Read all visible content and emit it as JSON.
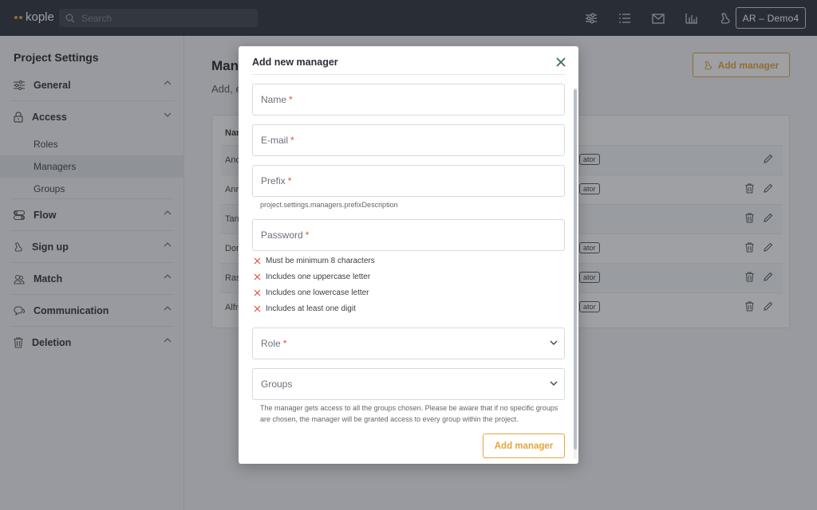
{
  "topbar": {
    "logo": "kople",
    "search_placeholder": "Search",
    "account_label": "AR – Demo4",
    "icons": [
      "sliders-icon",
      "list-icon",
      "mail-icon",
      "bar-chart-icon",
      "signup-icon"
    ]
  },
  "sidebar": {
    "title": "Project Settings",
    "sections": [
      {
        "label": "General",
        "icon": "sliders-icon"
      },
      {
        "label": "Access",
        "icon": "lock-icon",
        "items": [
          "Roles",
          "Managers",
          "Groups"
        ],
        "active": "Managers"
      },
      {
        "label": "Flow",
        "icon": "toggle-icon"
      },
      {
        "label": "Sign up",
        "icon": "signup-icon"
      },
      {
        "label": "Match",
        "icon": "people-icon"
      },
      {
        "label": "Communication",
        "icon": "chat-icon"
      },
      {
        "label": "Deletion",
        "icon": "trash-icon"
      }
    ]
  },
  "content": {
    "title": "Man",
    "subtitle": "Add, e",
    "add_button": "Add manager",
    "table_header": "Nar",
    "rows": [
      {
        "name": "And",
        "badge": "ator",
        "delete": false
      },
      {
        "name": "Ann",
        "badge": "ator",
        "delete": true
      },
      {
        "name": "Tan",
        "badge": "",
        "delete": true
      },
      {
        "name": "Dor",
        "badge": "ator",
        "delete": true
      },
      {
        "name": "Ras",
        "badge": "ator",
        "delete": true
      },
      {
        "name": "Alfr",
        "badge": "ator",
        "delete": true
      }
    ]
  },
  "modal": {
    "title": "Add new manager",
    "fields": {
      "name": {
        "label": "Name",
        "required": "*"
      },
      "email": {
        "label": "E-mail",
        "required": "*"
      },
      "prefix": {
        "label": "Prefix",
        "required": "*",
        "helper": "project.settings.managers.prefixDescription"
      },
      "password": {
        "label": "Password",
        "required": "*"
      },
      "role": {
        "label": "Role",
        "required": "*"
      },
      "groups": {
        "label": "Groups",
        "helper": "The manager gets access to all the groups chosen. Please be aware that if no specific groups are chosen, the manager will be granted access to every group within the project."
      }
    },
    "password_rules": [
      "Must be minimum 8 characters",
      "Includes one uppercase letter",
      "Includes one lowercase letter",
      "Includes at least one digit"
    ],
    "submit_label": "Add manager"
  },
  "colors": {
    "accent": "#e8a23b",
    "topbar": "#2b3039",
    "error": "#e0503a"
  }
}
